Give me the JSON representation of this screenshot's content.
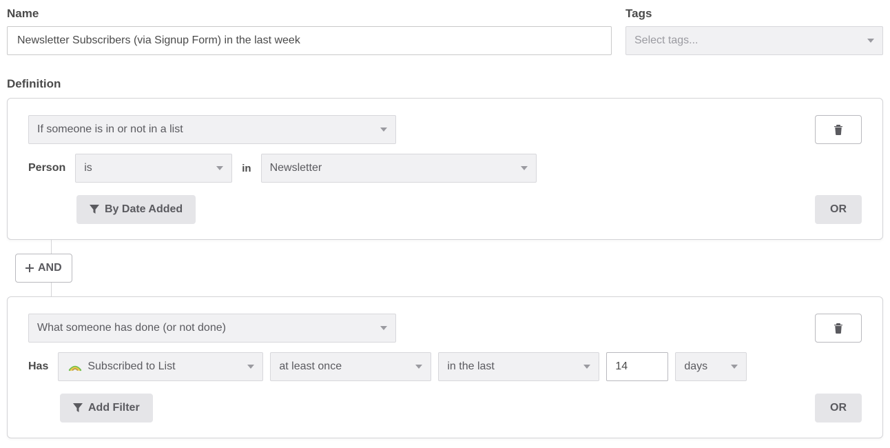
{
  "name": {
    "label": "Name",
    "value": "Newsletter Subscribers (via Signup Form) in the last week"
  },
  "tags": {
    "label": "Tags",
    "placeholder": "Select tags..."
  },
  "definition": {
    "label": "Definition"
  },
  "cond1": {
    "type": "If someone is in or not in a list",
    "person_label": "Person",
    "operator": "is",
    "in_label": "in",
    "list": "Newsletter",
    "filter_btn": "By Date Added",
    "or_label": "OR"
  },
  "connector": {
    "and_label": "AND"
  },
  "cond2": {
    "type": "What someone has done (or not done)",
    "has_label": "Has",
    "event": "Subscribed to List",
    "frequency": "at least once",
    "timeframe": "in the last",
    "count": "14",
    "unit": "days",
    "filter_btn": "Add Filter",
    "or_label": "OR"
  }
}
